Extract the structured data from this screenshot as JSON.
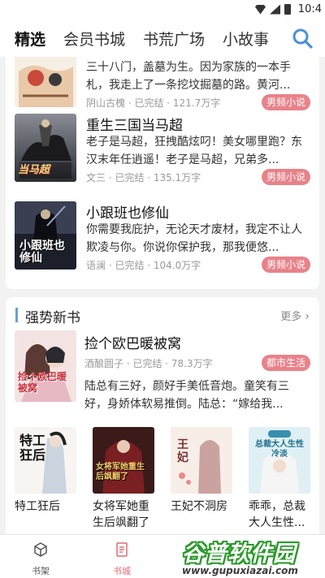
{
  "status": {
    "time": "10:4"
  },
  "nav": {
    "tabs": [
      "精选",
      "会员书城",
      "书荒广场",
      "小故事"
    ],
    "active_index": 0
  },
  "books": [
    {
      "title": "",
      "desc": "三十八门，盖墓为生。因为家族的一本手札，我走上了一条挖坟掘墓的路。黄河...",
      "meta": "阴山古槐 · 已完结 · 121.7万字",
      "tag": "男频小说",
      "cover_text": ""
    },
    {
      "title": "重生三国当马超",
      "desc": "老子是马超，狂拽酷炫叼！美女哪里跑？东汉末年任逍遥！老子是马超，兄弟多...",
      "meta": "文三 · 已完结 · 135.1万字",
      "tag": "男频小说",
      "cover_text": "当马超"
    },
    {
      "title": "小跟班也修仙",
      "desc": "你需要我庇护，无论天才废材，我定不让人欺凌与你。你说你保护我，那我便悠...",
      "meta": "语澜 · 已完结 · 104.0万字",
      "tag": "男频小说",
      "cover_text": "小跟班也修仙"
    }
  ],
  "new_section": {
    "title": "强势新书",
    "more": "更多",
    "highlight": {
      "title": "捡个欧巴暖被窝",
      "meta": "酒酿圆子 · 已完结 · 78.3万字",
      "tag": "都市生活",
      "desc": "陆总有三好，颜好手美低音炮。童笑有三好，身娇体软易推倒。陆总：“嫁给我...",
      "cover_text": "捡个欧巴暖被窝"
    },
    "grid": [
      {
        "title": "特工狂后",
        "cover_text": "特工狂后"
      },
      {
        "title": "女将军她重生后飒翻了",
        "cover_text": "女将军她重生后飒翻了"
      },
      {
        "title": "王妃不洞房",
        "cover_text": "王妃"
      },
      {
        "title": "乖乖，总裁大人生性...",
        "cover_text": "总裁大人生性冷淡"
      }
    ]
  },
  "bottom_nav": [
    {
      "label": "书架"
    },
    {
      "label": "书城"
    }
  ],
  "watermark": {
    "brand": "谷普软件园",
    "url": "www.gupuxiazai.com"
  },
  "colors": {
    "tag": "#e8828a",
    "accent": "#e26a74",
    "section_bar": "#6a9fd8",
    "search": "#4a90d9"
  }
}
